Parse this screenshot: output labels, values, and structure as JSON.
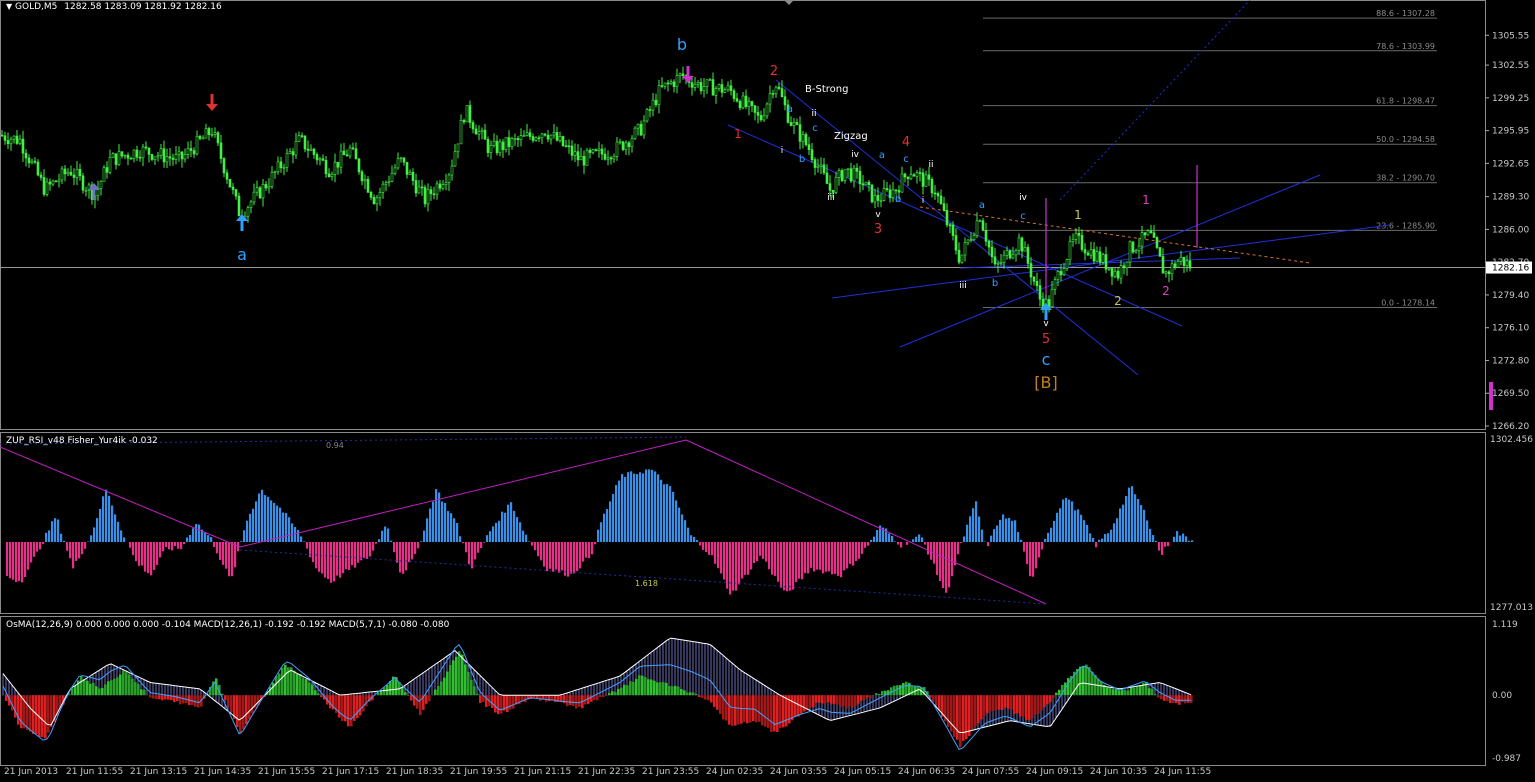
{
  "main": {
    "title": "GOLD,M5",
    "ohlc": "1282.58 1283.09 1281.92 1282.16",
    "current_price": "1282.16",
    "price_ticks": [
      "1305.55",
      "1302.55",
      "1299.25",
      "1295.95",
      "1292.65",
      "1289.30",
      "1286.00",
      "1282.70",
      "1279.40",
      "1276.10",
      "1272.80",
      "1269.50",
      "1266.20"
    ],
    "fib_levels": [
      {
        "label": "88.6 - 1307.28",
        "value": 1307.28
      },
      {
        "label": "78.6 - 1303.99",
        "value": 1303.99
      },
      {
        "label": "61.8 - 1298.47",
        "value": 1298.47
      },
      {
        "label": "50.0 - 1294.58",
        "value": 1294.58
      },
      {
        "label": "38.2 - 1290.70",
        "value": 1290.7
      },
      {
        "label": "23.6 - 1285.90",
        "value": 1285.9
      },
      {
        "label": "0.0 - 1278.14",
        "value": 1278.14
      }
    ],
    "annotations": {
      "b_strong": "B-Strong",
      "zigzag": "Zigzag"
    },
    "wave_labels": [
      {
        "t": "a",
        "c": "#2fa0ff",
        "x": 242,
        "y": 260,
        "s": 16
      },
      {
        "t": "b",
        "c": "#2fa0ff",
        "x": 682,
        "y": 50,
        "s": 16
      },
      {
        "t": "c",
        "c": "#2fa0ff",
        "x": 1046,
        "y": 365,
        "s": 16
      },
      {
        "t": "[B]",
        "c": "#c08020",
        "x": 1046,
        "y": 388,
        "s": 16
      },
      {
        "t": "1",
        "c": "#e03030",
        "x": 738,
        "y": 138,
        "s": 12
      },
      {
        "t": "2",
        "c": "#e03030",
        "x": 774,
        "y": 75,
        "s": 13
      },
      {
        "t": "3",
        "c": "#e03030",
        "x": 878,
        "y": 233,
        "s": 13
      },
      {
        "t": "4",
        "c": "#e03030",
        "x": 906,
        "y": 146,
        "s": 13
      },
      {
        "t": "5",
        "c": "#e03030",
        "x": 1046,
        "y": 343,
        "s": 13
      },
      {
        "t": "a",
        "c": "#2fa0ff",
        "x": 790,
        "y": 112,
        "s": 10
      },
      {
        "t": "b",
        "c": "#2fa0ff",
        "x": 802,
        "y": 162,
        "s": 10
      },
      {
        "t": "c",
        "c": "#2fa0ff",
        "x": 815,
        "y": 131,
        "s": 10
      },
      {
        "t": "a",
        "c": "#2fa0ff",
        "x": 882,
        "y": 158,
        "s": 10
      },
      {
        "t": "b",
        "c": "#2fa0ff",
        "x": 898,
        "y": 202,
        "s": 10
      },
      {
        "t": "c",
        "c": "#2fa0ff",
        "x": 906,
        "y": 162,
        "s": 10
      },
      {
        "t": "a",
        "c": "#2fa0ff",
        "x": 982,
        "y": 208,
        "s": 10
      },
      {
        "t": "b",
        "c": "#2fa0ff",
        "x": 995,
        "y": 286,
        "s": 10
      },
      {
        "t": "c",
        "c": "#2fa0ff",
        "x": 1023,
        "y": 219,
        "s": 10
      },
      {
        "t": "i",
        "c": "#ffffff",
        "x": 782,
        "y": 153,
        "s": 9
      },
      {
        "t": "ii",
        "c": "#ffffff",
        "x": 814,
        "y": 116,
        "s": 9
      },
      {
        "t": "iii",
        "c": "#ffffff",
        "x": 831,
        "y": 200,
        "s": 9
      },
      {
        "t": "iv",
        "c": "#ffffff",
        "x": 855,
        "y": 157,
        "s": 9
      },
      {
        "t": "v",
        "c": "#ffffff",
        "x": 878,
        "y": 217,
        "s": 9
      },
      {
        "t": "i",
        "c": "#ffffff",
        "x": 923,
        "y": 203,
        "s": 9
      },
      {
        "t": "ii",
        "c": "#ffffff",
        "x": 931,
        "y": 167,
        "s": 9
      },
      {
        "t": "iii",
        "c": "#ffffff",
        "x": 963,
        "y": 288,
        "s": 9
      },
      {
        "t": "iv",
        "c": "#ffffff",
        "x": 1023,
        "y": 200,
        "s": 9
      },
      {
        "t": "v",
        "c": "#ffffff",
        "x": 1046,
        "y": 326,
        "s": 9
      },
      {
        "t": "1",
        "c": "#c8c850",
        "x": 1078,
        "y": 219,
        "s": 12
      },
      {
        "t": "2",
        "c": "#c8c850",
        "x": 1118,
        "y": 305,
        "s": 12
      },
      {
        "t": "1",
        "c": "#e040c0",
        "x": 1146,
        "y": 204,
        "s": 12
      },
      {
        "t": "2",
        "c": "#e040c0",
        "x": 1166,
        "y": 295,
        "s": 12
      }
    ]
  },
  "rsi": {
    "title": "ZUP_RSI_v48  Fisher_Yur4ik -0.032",
    "ticks": [
      "1302.456",
      "1277.013"
    ],
    "label_094": "0.94",
    "label_1618": "1.618"
  },
  "osma": {
    "title": "OsMA(12,26,9) 0.000 0.000 0.000 -0.104  MACD(12,26,1) -0.192 -0.192  MACD(5,7,1) -0.080 -0.080",
    "ticks": [
      "1.119",
      "0.00",
      "-0.987"
    ]
  },
  "time_axis": [
    "21 Jun 2013",
    "21 Jun 11:55",
    "21 Jun 13:15",
    "21 Jun 14:35",
    "21 Jun 15:55",
    "21 Jun 17:15",
    "21 Jun 18:35",
    "21 Jun 19:55",
    "21 Jun 21:15",
    "21 Jun 22:35",
    "21 Jun 23:55",
    "24 Jun 02:35",
    "24 Jun 03:55",
    "24 Jun 05:15",
    "24 Jun 06:35",
    "24 Jun 07:55",
    "24 Jun 09:15",
    "24 Jun 10:35",
    "24 Jun 11:55"
  ],
  "chart_data": [
    {
      "type": "candlestick",
      "title": "GOLD,M5",
      "ylim": [
        1266.2,
        1308.5
      ],
      "current": 1282.16,
      "keypoints_price": [
        [
          0,
          1295.5
        ],
        [
          20,
          1295
        ],
        [
          45,
          1290
        ],
        [
          70,
          1292
        ],
        [
          95,
          1289.5
        ],
        [
          110,
          1293
        ],
        [
          140,
          1294
        ],
        [
          180,
          1293
        ],
        [
          212,
          1296
        ],
        [
          240,
          1287.5
        ],
        [
          270,
          1291
        ],
        [
          300,
          1295
        ],
        [
          330,
          1292
        ],
        [
          350,
          1294
        ],
        [
          375,
          1289
        ],
        [
          400,
          1293
        ],
        [
          425,
          1289
        ],
        [
          450,
          1292
        ],
        [
          465,
          1298
        ],
        [
          490,
          1294
        ],
        [
          520,
          1295
        ],
        [
          545,
          1296
        ],
        [
          580,
          1293
        ],
        [
          615,
          1294
        ],
        [
          640,
          1296
        ],
        [
          660,
          1300
        ],
        [
          682,
          1301.5
        ],
        [
          700,
          1300.5
        ],
        [
          730,
          1300
        ],
        [
          760,
          1297
        ],
        [
          775,
          1301
        ],
        [
          790,
          1297
        ],
        [
          810,
          1294
        ],
        [
          830,
          1290
        ],
        [
          845,
          1292
        ],
        [
          860,
          1291
        ],
        [
          875,
          1289
        ],
        [
          895,
          1290
        ],
        [
          910,
          1292
        ],
        [
          935,
          1290
        ],
        [
          960,
          1283
        ],
        [
          980,
          1287.5
        ],
        [
          995,
          1282
        ],
        [
          1020,
          1285
        ],
        [
          1040,
          1279
        ],
        [
          1048,
          1278.3
        ],
        [
          1060,
          1282
        ],
        [
          1075,
          1285
        ],
        [
          1095,
          1283.5
        ],
        [
          1118,
          1281.5
        ],
        [
          1130,
          1284
        ],
        [
          1150,
          1285.5
        ],
        [
          1165,
          1281.5
        ],
        [
          1180,
          1283
        ],
        [
          1192,
          1282.2
        ]
      ]
    },
    {
      "type": "bar",
      "title": "ZUP_RSI_v48  Fisher_Yur4ik -0.032",
      "ylim": [
        -1,
        1
      ],
      "keypoints": [
        [
          0,
          -0.5
        ],
        [
          20,
          -0.6
        ],
        [
          35,
          -0.2
        ],
        [
          55,
          0.4
        ],
        [
          72,
          -0.4
        ],
        [
          90,
          0.1
        ],
        [
          105,
          0.8
        ],
        [
          120,
          0.2
        ],
        [
          135,
          -0.3
        ],
        [
          150,
          -0.5
        ],
        [
          165,
          -0.1
        ],
        [
          180,
          -0.1
        ],
        [
          195,
          0.3
        ],
        [
          210,
          0.05
        ],
        [
          230,
          -0.6
        ],
        [
          245,
          0.3
        ],
        [
          260,
          0.8
        ],
        [
          280,
          0.5
        ],
        [
          300,
          0.1
        ],
        [
          315,
          -0.4
        ],
        [
          330,
          -0.6
        ],
        [
          350,
          -0.4
        ],
        [
          370,
          -0.2
        ],
        [
          385,
          0.3
        ],
        [
          400,
          -0.5
        ],
        [
          415,
          -0.2
        ],
        [
          435,
          0.8
        ],
        [
          455,
          0.3
        ],
        [
          470,
          -0.4
        ],
        [
          490,
          0.2
        ],
        [
          510,
          0.6
        ],
        [
          525,
          0.1
        ],
        [
          545,
          -0.4
        ],
        [
          570,
          -0.5
        ],
        [
          590,
          -0.2
        ],
        [
          600,
          0.3
        ],
        [
          620,
          1.0
        ],
        [
          650,
          1.1
        ],
        [
          670,
          0.8
        ],
        [
          690,
          0.1
        ],
        [
          710,
          -0.2
        ],
        [
          730,
          -0.8
        ],
        [
          760,
          -0.2
        ],
        [
          785,
          -0.8
        ],
        [
          810,
          -0.4
        ],
        [
          840,
          -0.5
        ],
        [
          860,
          -0.2
        ],
        [
          880,
          0.25
        ],
        [
          900,
          -0.05
        ],
        [
          920,
          0.1
        ],
        [
          945,
          -0.8
        ],
        [
          965,
          0.2
        ],
        [
          975,
          0.6
        ],
        [
          985,
          -0.1
        ],
        [
          1000,
          0.4
        ],
        [
          1015,
          0.3
        ],
        [
          1030,
          -0.6
        ],
        [
          1045,
          0.1
        ],
        [
          1065,
          0.7
        ],
        [
          1080,
          0.4
        ],
        [
          1095,
          -0.05
        ],
        [
          1110,
          0.2
        ],
        [
          1130,
          0.85
        ],
        [
          1145,
          0.4
        ],
        [
          1160,
          -0.2
        ],
        [
          1175,
          0.15
        ],
        [
          1192,
          0.02
        ]
      ]
    },
    {
      "type": "bar",
      "title": "OsMA(12,26,9) 0.000 0.000 0.000 -0.104  MACD(12,26,1) -0.192 -0.192  MACD(5,7,1) -0.080 -0.080",
      "ylim": [
        -0.987,
        1.119
      ],
      "keypoints_osma": [
        [
          0,
          0.1
        ],
        [
          20,
          -0.5
        ],
        [
          45,
          -0.7
        ],
        [
          60,
          -0.2
        ],
        [
          80,
          0.3
        ],
        [
          100,
          0.1
        ],
        [
          125,
          0.4
        ],
        [
          150,
          -0.05
        ],
        [
          175,
          -0.1
        ],
        [
          200,
          -0.2
        ],
        [
          215,
          0.3
        ],
        [
          240,
          -0.6
        ],
        [
          260,
          -0.1
        ],
        [
          285,
          0.5
        ],
        [
          310,
          0.2
        ],
        [
          330,
          -0.2
        ],
        [
          350,
          -0.5
        ],
        [
          370,
          -0.1
        ],
        [
          395,
          0.3
        ],
        [
          420,
          -0.3
        ],
        [
          440,
          0.2
        ],
        [
          460,
          0.7
        ],
        [
          480,
          -0.1
        ],
        [
          500,
          -0.3
        ],
        [
          530,
          -0.05
        ],
        [
          555,
          -0.1
        ],
        [
          580,
          -0.2
        ],
        [
          600,
          -0.05
        ],
        [
          620,
          0.1
        ],
        [
          640,
          0.3
        ],
        [
          660,
          0.2
        ],
        [
          690,
          0.05
        ],
        [
          710,
          -0.1
        ],
        [
          730,
          -0.5
        ],
        [
          755,
          -0.4
        ],
        [
          775,
          -0.6
        ],
        [
          800,
          -0.3
        ],
        [
          820,
          -0.1
        ],
        [
          850,
          -0.2
        ],
        [
          880,
          0.05
        ],
        [
          905,
          0.2
        ],
        [
          925,
          0.1
        ],
        [
          945,
          -0.4
        ],
        [
          960,
          -0.8
        ],
        [
          985,
          -0.3
        ],
        [
          1005,
          -0.2
        ],
        [
          1030,
          -0.4
        ],
        [
          1050,
          -0.1
        ],
        [
          1070,
          0.3
        ],
        [
          1085,
          0.5
        ],
        [
          1100,
          0.2
        ],
        [
          1120,
          0.05
        ],
        [
          1145,
          0.2
        ],
        [
          1160,
          -0.05
        ],
        [
          1175,
          -0.15
        ],
        [
          1192,
          -0.1
        ]
      ],
      "keypoints_macd": [
        [
          0,
          0.4
        ],
        [
          30,
          -0.2
        ],
        [
          50,
          -0.5
        ],
        [
          70,
          0.1
        ],
        [
          110,
          0.5
        ],
        [
          150,
          0.2
        ],
        [
          200,
          0.1
        ],
        [
          240,
          -0.4
        ],
        [
          290,
          0.4
        ],
        [
          340,
          0.0
        ],
        [
          400,
          0.1
        ],
        [
          455,
          0.7
        ],
        [
          500,
          0.0
        ],
        [
          560,
          0.0
        ],
        [
          620,
          0.3
        ],
        [
          670,
          0.9
        ],
        [
          710,
          0.8
        ],
        [
          740,
          0.4
        ],
        [
          780,
          0.0
        ],
        [
          830,
          -0.4
        ],
        [
          880,
          -0.2
        ],
        [
          920,
          0.1
        ],
        [
          960,
          -0.6
        ],
        [
          1010,
          -0.4
        ],
        [
          1050,
          -0.5
        ],
        [
          1080,
          0.2
        ],
        [
          1120,
          0.1
        ],
        [
          1160,
          0.2
        ],
        [
          1192,
          0.0
        ]
      ]
    }
  ]
}
